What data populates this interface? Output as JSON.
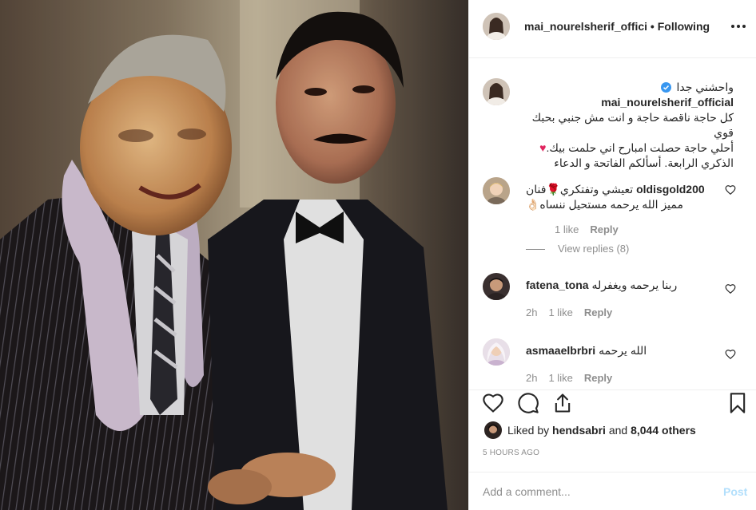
{
  "header": {
    "username": "mai_nourelsherif_offici",
    "separator": " • ",
    "follow_status": "Following",
    "more_icon": "more-horizontal-icon"
  },
  "caption": {
    "username": "mai_nourelsherif_official",
    "verified_icon": "verified-badge-icon",
    "lines": [
      "واحشني جدا",
      "كل حاجة ناقصة حاجة و انت مش جنبي بحبك قوي",
      "أحلي حاجة حصلت امبارح اني حلمت بيك.",
      "الذكري الرابعة. أسألكم الفاتحة و الدعاء"
    ],
    "heart_emoji": "♥"
  },
  "comments": [
    {
      "username": "oldisgold200",
      "text_line1": "تعيشي وتفتكري🌹فنان",
      "text_line2": "مميز الله يرحمه مستحيل ننساه👌🏻",
      "likes": "1 like",
      "reply": "Reply",
      "view_replies": "View replies (8)"
    },
    {
      "username": "fatena_tona",
      "text_line1": "ربنا يرحمه ويغفرله",
      "time": "2h",
      "likes": "1 like",
      "reply": "Reply"
    },
    {
      "username": "asmaaelbrbri",
      "text_line1": "الله يرحمه",
      "time": "2h",
      "likes": "1 like",
      "reply": "Reply"
    }
  ],
  "actions": {
    "like_icon": "heart-outline-icon",
    "comment_icon": "comment-bubble-icon",
    "share_icon": "share-icon",
    "save_icon": "bookmark-icon"
  },
  "likes": {
    "prefix": "Liked by ",
    "user": "hendsabri",
    "middle": " and ",
    "count": "8,044 others"
  },
  "timestamp": "5 HOURS AGO",
  "add_comment": {
    "placeholder": "Add a comment...",
    "post_label": "Post"
  },
  "colors": {
    "post_button_disabled": "#b2dffc",
    "muted_text": "#8e8e8e",
    "verified_blue": "#3897f0",
    "heart_red": "#e0245e"
  }
}
